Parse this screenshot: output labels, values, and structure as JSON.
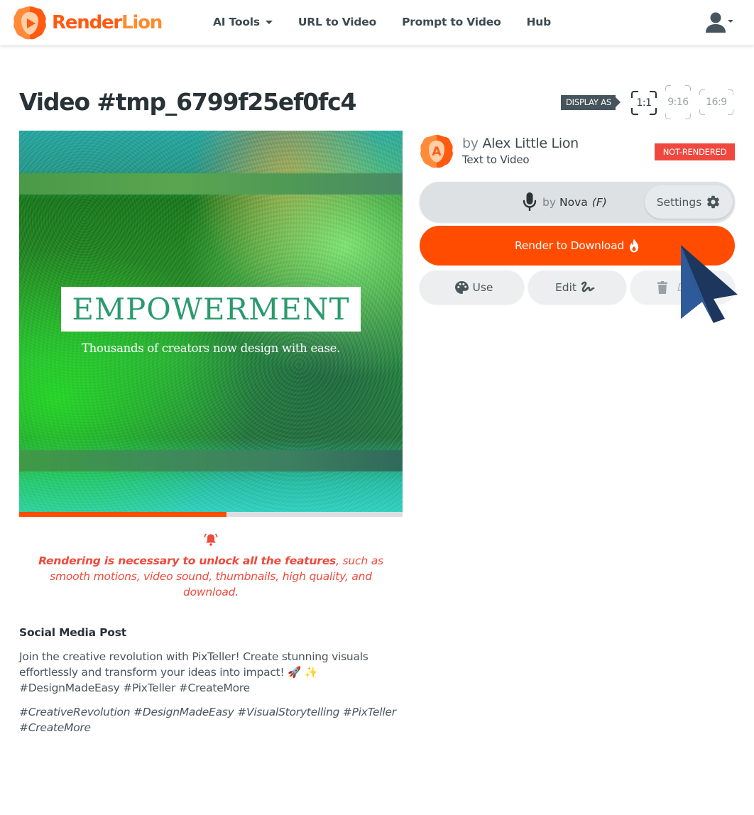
{
  "navbar": {
    "brand_part1": "Render",
    "brand_part2": "Lion",
    "links": [
      {
        "label": "AI Tools",
        "has_dropdown": true
      },
      {
        "label": "URL to Video"
      },
      {
        "label": "Prompt to Video"
      },
      {
        "label": "Hub"
      }
    ],
    "user_menu_icon": "user-icon"
  },
  "page": {
    "title": "Video #tmp_6799f25ef0fc4",
    "display_as_label": "DISPLAY AS",
    "ratios": [
      {
        "label": "1:1",
        "active": true
      },
      {
        "label": "9:16",
        "active": false
      },
      {
        "label": "16:9",
        "active": false
      }
    ]
  },
  "video": {
    "headline": "EMPOWERMENT",
    "subtitle": "Thousands of creators now design with ease.",
    "progress_percent": 54
  },
  "notice": {
    "icon": "bell-icon",
    "bold_text": "Rendering is necessary to unlock all the features",
    "rest_text": ", such as smooth motions, video sound, thumbnails, high quality, and download."
  },
  "post": {
    "title": "Social Media Post",
    "body": "Join the creative revolution with PixTeller! Create stunning visuals effortlessly and transform your ideas into impact! 🚀 ✨ #DesignMadeEasy #PixTeller #CreateMore",
    "tags": "#CreativeRevolution #DesignMadeEasy #VisualStorytelling #PixTeller #CreateMore"
  },
  "author": {
    "avatar_letter": "A",
    "by_label": "by",
    "name": "Alex Little Lion",
    "type": "Text to Video",
    "status": "NOT-RENDERED"
  },
  "voice": {
    "by_label": "by",
    "name": "Nova",
    "gender": "(F)",
    "settings_label": "Settings"
  },
  "actions": {
    "render_label": "Render to Download",
    "use_label": "Use",
    "edit_label": "Edit",
    "delete_label": "Delete"
  },
  "colors": {
    "brand_orange": "#ff4c00",
    "badge_red": "#f0483e",
    "notice_red": "#ef4a3a",
    "text_dark": "#283237"
  }
}
